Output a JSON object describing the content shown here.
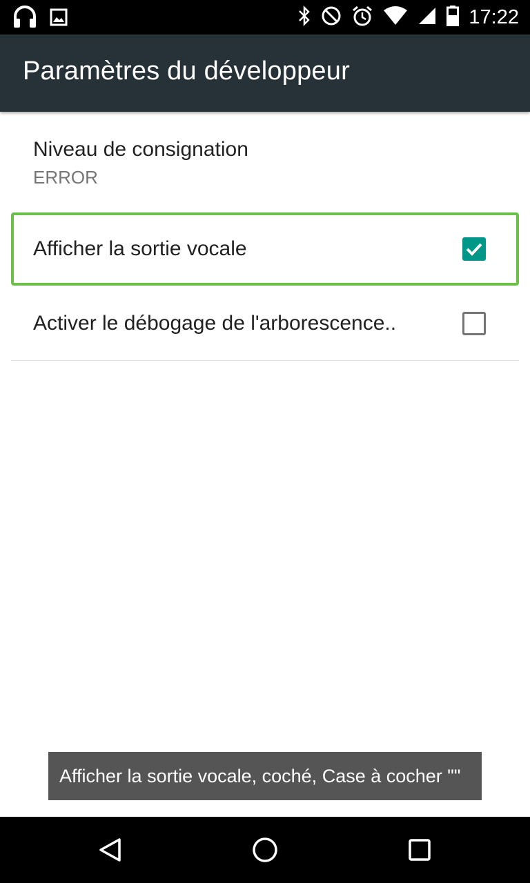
{
  "status_bar": {
    "time": "17:22",
    "left_icons": [
      "headphones-icon",
      "image-icon"
    ],
    "right_icons": [
      "bluetooth-icon",
      "do-not-disturb-icon",
      "alarm-icon",
      "wifi-icon",
      "cell-signal-icon",
      "battery-icon"
    ]
  },
  "app_bar": {
    "title": "Paramètres du développeur"
  },
  "preferences": [
    {
      "title": "Niveau de consignation",
      "summary": "ERROR"
    },
    {
      "title": "Afficher la sortie vocale",
      "checked": true
    },
    {
      "title": "Activer le débogage de l'arborescence..",
      "checked": false
    }
  ],
  "toast": {
    "text": "Afficher la sortie vocale, coché, Case à cocher \"\""
  },
  "nav_bar": {
    "buttons": [
      "back-icon",
      "home-icon",
      "recents-icon"
    ]
  },
  "colors": {
    "app_bar": "#263238",
    "accent": "#009688",
    "focus_outline": "#6cc04a",
    "toast_bg": "#555555"
  }
}
